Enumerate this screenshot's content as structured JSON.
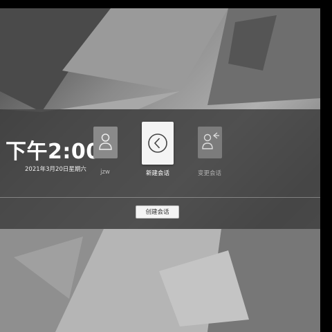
{
  "clock": {
    "time": "下午2:00",
    "date": "2021年3月20日星期六"
  },
  "users": [
    {
      "name": "jzw",
      "icon": "user-icon"
    },
    {
      "name": "新建会话",
      "icon": "back-arrow-icon"
    },
    {
      "name": "变更会话",
      "icon": "switch-user-icon"
    }
  ],
  "actions": {
    "create_session": "创建会话"
  },
  "colors": {
    "panel": "#3a3a3a",
    "selected_tile": "#f4f4f4"
  }
}
